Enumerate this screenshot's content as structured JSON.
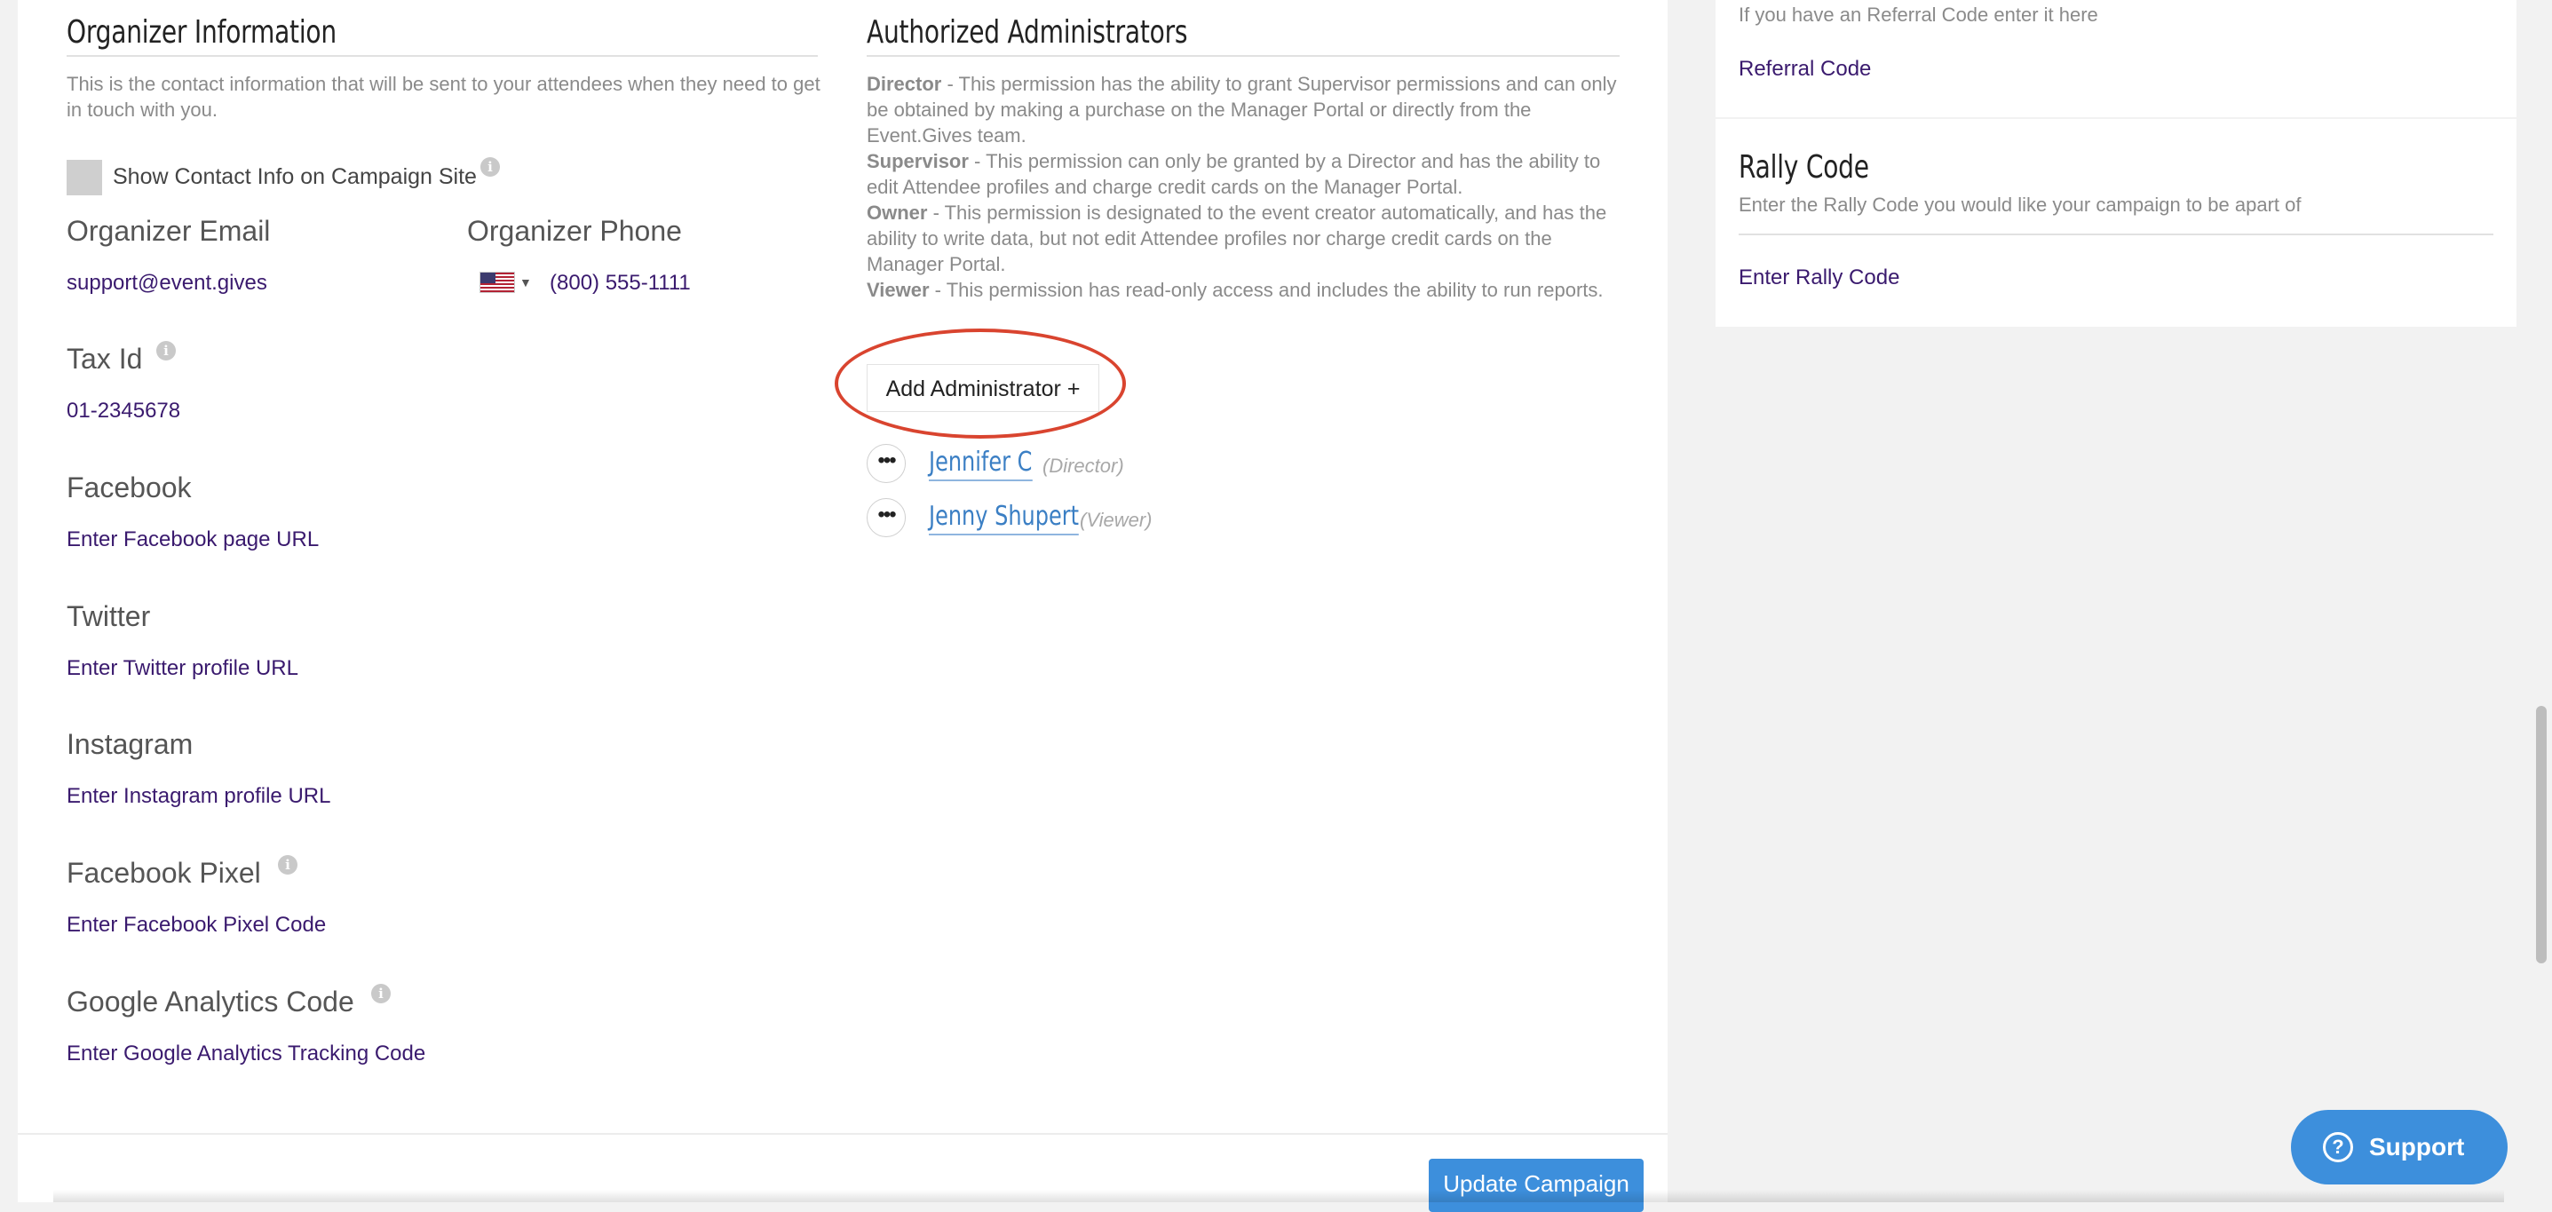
{
  "organizer": {
    "title": "Organizer Information",
    "description": "This is the contact information that will be sent to your attendees when they need to get in touch with you.",
    "show_contact_label": "Show Contact Info on Campaign Site",
    "email_label": "Organizer Email",
    "email_value": "support@event.gives",
    "phone_label": "Organizer Phone",
    "phone_value": "(800) 555-1111",
    "tax_label": "Tax Id",
    "tax_value": "01-2345678",
    "facebook_label": "Facebook",
    "facebook_placeholder": "Enter Facebook page URL",
    "twitter_label": "Twitter",
    "twitter_placeholder": "Enter Twitter profile URL",
    "instagram_label": "Instagram",
    "instagram_placeholder": "Enter Instagram profile URL",
    "pixel_label": "Facebook Pixel",
    "pixel_placeholder": "Enter Facebook Pixel Code",
    "ga_label": "Google Analytics Code",
    "ga_placeholder": "Enter Google Analytics Tracking Code"
  },
  "admins": {
    "title": "Authorized Administrators",
    "permissions": [
      {
        "role": "Director",
        "text": " - This permission has the ability to grant Supervisor permissions and can only be obtained by making a purchase on the Manager Portal or directly from the Event.Gives team."
      },
      {
        "role": "Supervisor",
        "text": " - This permission can only be granted by a Director and has the ability to edit Attendee profiles and charge credit cards on the Manager Portal."
      },
      {
        "role": "Owner",
        "text": " - This permission is designated to the event creator automatically, and has the ability to write data, but not edit Attendee profiles nor charge credit cards on the Manager Portal."
      },
      {
        "role": "Viewer",
        "text": " - This permission has read-only access and includes the ability to run reports."
      }
    ],
    "add_button": "Add Administrator +",
    "list": [
      {
        "name": "Jennifer C",
        "role": "(Director)"
      },
      {
        "name": "Jenny Shupert",
        "role": "(Viewer)"
      }
    ]
  },
  "sidebar": {
    "referral_hint": "If you have an Referral Code enter it here",
    "referral_placeholder": "Referral Code",
    "rally_title": "Rally Code",
    "rally_description": "Enter the Rally Code you would like your campaign to be apart of",
    "rally_placeholder": "Enter Rally Code"
  },
  "footer": {
    "update_button": "Update Campaign"
  },
  "support": {
    "label": "Support"
  },
  "colors": {
    "accent": "#3d8fdc",
    "link": "#3b7fc4",
    "value_text": "#3a1a6e",
    "highlight": "#d9442f"
  },
  "icons": {
    "info": "info-icon",
    "flag": "us-flag-icon",
    "more": "ellipsis-icon",
    "help": "question-circle-icon"
  }
}
